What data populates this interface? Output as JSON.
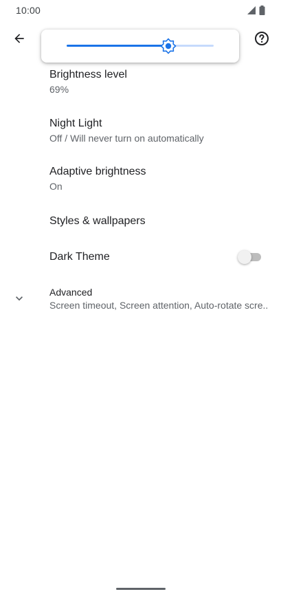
{
  "status_bar": {
    "time": "10:00",
    "icons": [
      "signal-icon",
      "battery-icon"
    ]
  },
  "app_bar": {
    "back_icon": "arrow-left-icon",
    "help_icon": "help-circle-icon"
  },
  "brightness_slider": {
    "value": 0.69,
    "track_color": "#c6dafc",
    "fill_color": "#1a73e8",
    "thumb_icon": "brightness-sun-icon"
  },
  "settings": {
    "brightness_level": {
      "title": "Brightness level",
      "summary": "69%"
    },
    "night_light": {
      "title": "Night Light",
      "summary": "Off / Will never turn on automatically"
    },
    "adaptive_brightness": {
      "title": "Adaptive brightness",
      "summary": "On"
    },
    "styles_wallpapers": {
      "title": "Styles & wallpapers"
    },
    "dark_theme": {
      "title": "Dark Theme",
      "enabled": false
    },
    "advanced": {
      "title": "Advanced",
      "summary": "Screen timeout, Screen attention, Auto-rotate scre..",
      "icon": "chevron-down-icon"
    }
  },
  "colors": {
    "accent": "#1a73e8",
    "text_primary": "#202124",
    "text_secondary": "#5f6368"
  }
}
